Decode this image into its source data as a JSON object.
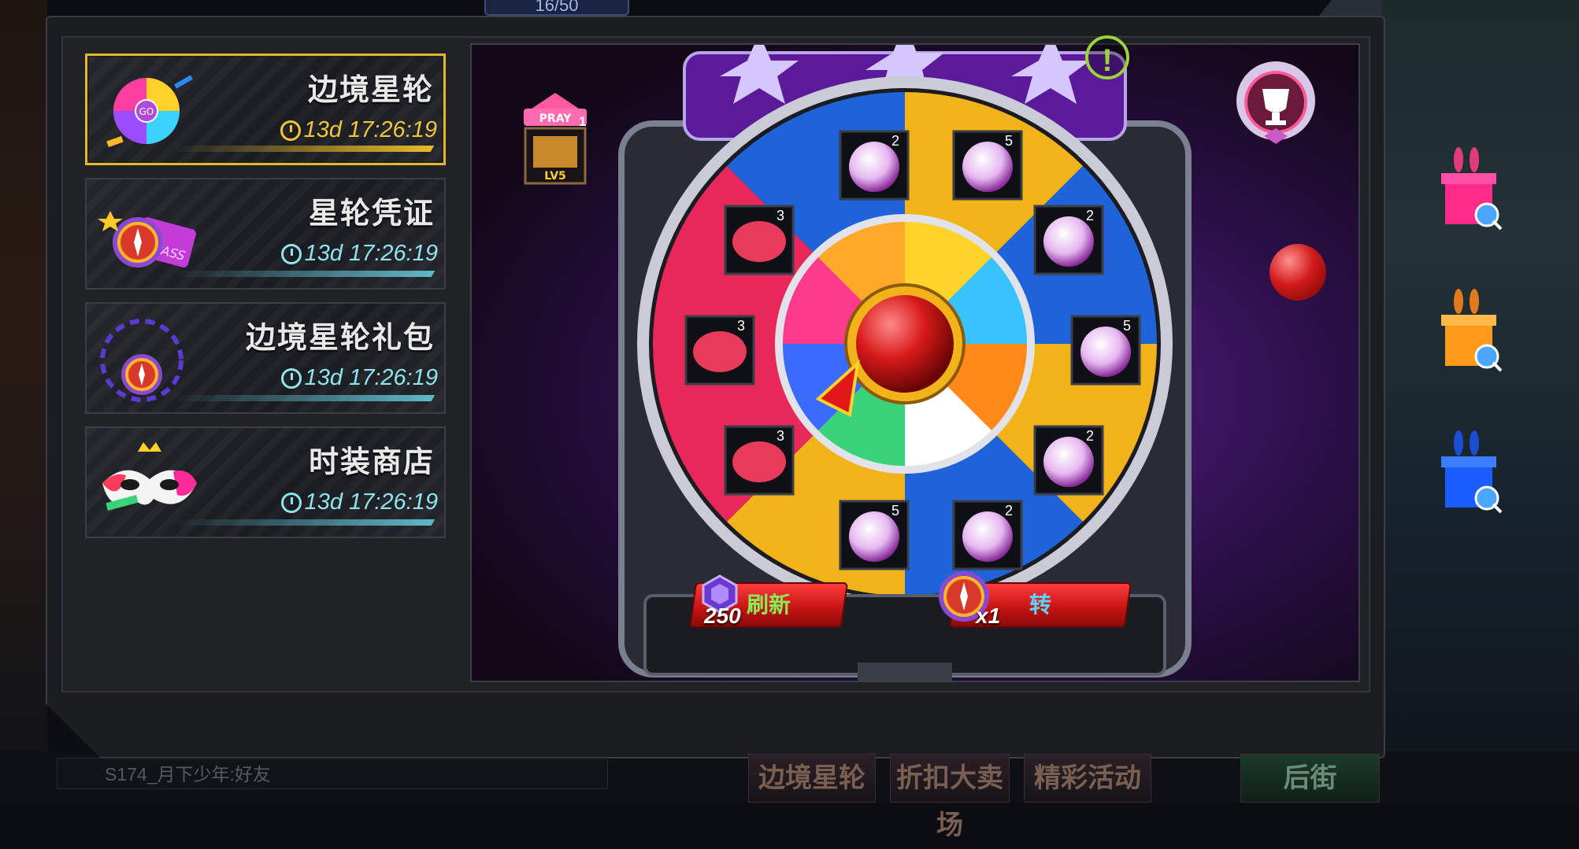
{
  "top_counter": "16/50",
  "tabs": [
    {
      "title": "边境星轮",
      "timer": "13d 17:26:19",
      "active": true
    },
    {
      "title": "星轮凭证",
      "timer": "13d 17:26:19",
      "active": false
    },
    {
      "title": "边境星轮礼包",
      "timer": "13d 17:26:19",
      "active": false
    },
    {
      "title": "时装商店",
      "timer": "13d 17:26:19",
      "active": false
    }
  ],
  "icon_text": {
    "go": "GO",
    "pass": "PASS",
    "pray": "PRAY",
    "level": "LV5"
  },
  "pray_badge_count": "1",
  "wheel_counts": [
    "2",
    "5",
    "2",
    "5",
    "2",
    "2",
    "5",
    "3",
    "3",
    "3"
  ],
  "refresh": {
    "label": "刷新",
    "cost": "250"
  },
  "spin": {
    "label": "转",
    "cost": "x1"
  },
  "chat_text": "S174_月下少年:好友",
  "bottom_tabs": [
    "边境星轮",
    "折扣大卖场",
    "精彩活动",
    "后街"
  ],
  "exclaim": "!",
  "colors": {
    "accent_gold": "#e1b82a",
    "timer_cyan": "#8fe4f0",
    "button_red": "#c31212",
    "refresh_green": "#88ee55",
    "spin_blue": "#55d7ff"
  }
}
